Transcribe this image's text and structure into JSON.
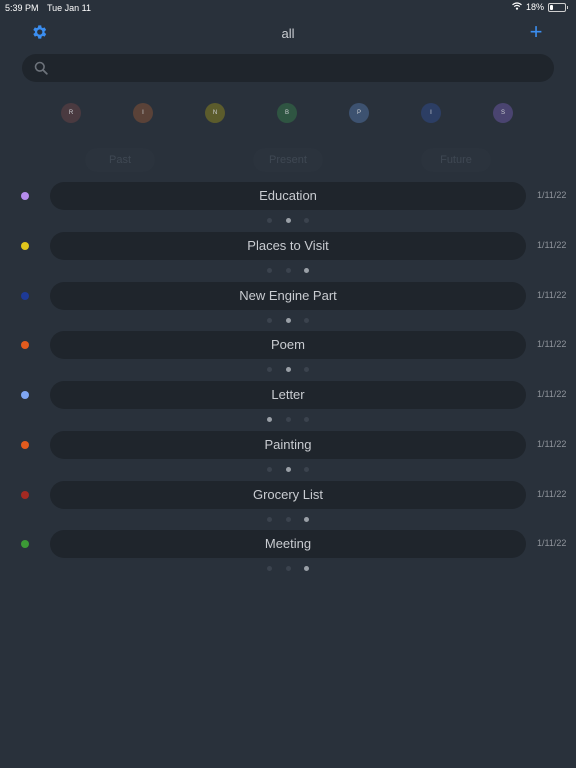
{
  "status_bar": {
    "time": "5:39 PM",
    "date": "Tue Jan 11",
    "battery": "18%"
  },
  "header": {
    "title": "all",
    "settings_icon": "gear-icon",
    "add_label": "+"
  },
  "search": {
    "placeholder": "",
    "value": ""
  },
  "filters": [
    {
      "letter": "R",
      "color": "#4a3a40"
    },
    {
      "letter": "I",
      "color": "#5a4238"
    },
    {
      "letter": "N",
      "color": "#5c5c2c"
    },
    {
      "letter": "B",
      "color": "#2f5542"
    },
    {
      "letter": "P",
      "color": "#3d5270"
    },
    {
      "letter": "I",
      "color": "#2c3e64"
    },
    {
      "letter": "S",
      "color": "#4a4470"
    }
  ],
  "time_segments": [
    "Past",
    "Present",
    "Future"
  ],
  "notes": [
    {
      "title": "Education",
      "date": "1/11/22",
      "color": "#b58ced",
      "active_page": 1
    },
    {
      "title": "Places to Visit",
      "date": "1/11/22",
      "color": "#e0c51c",
      "active_page": 2
    },
    {
      "title": "New Engine Part",
      "date": "1/11/22",
      "color": "#1e3a96",
      "active_page": 1
    },
    {
      "title": "Poem",
      "date": "1/11/22",
      "color": "#e25b1e",
      "active_page": 1
    },
    {
      "title": "Letter",
      "date": "1/11/22",
      "color": "#7fa6f2",
      "active_page": 0
    },
    {
      "title": "Painting",
      "date": "1/11/22",
      "color": "#e25b1e",
      "active_page": 1
    },
    {
      "title": "Grocery List",
      "date": "1/11/22",
      "color": "#a32a22",
      "active_page": 2
    },
    {
      "title": "Meeting",
      "date": "1/11/22",
      "color": "#3c9a36",
      "active_page": 2
    }
  ]
}
